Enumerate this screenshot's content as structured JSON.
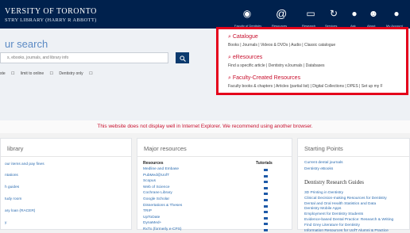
{
  "header": {
    "university": "VERSITY OF TORONTO",
    "library": "STRY LIBRARY (HARRY R ABBOTT)",
    "nav": [
      {
        "label": "Faculty of Dentistry",
        "icon": "target-icon"
      },
      {
        "label": "Resources",
        "icon": "at-icon"
      },
      {
        "label": "Research",
        "icon": "laptop-icon"
      },
      {
        "label": "Services",
        "icon": "refresh-icon"
      },
      {
        "label": "Ask",
        "icon": "chat-icon"
      },
      {
        "label": "About",
        "icon": "face-icon"
      },
      {
        "label": "My Account",
        "icon": "user-icon"
      }
    ]
  },
  "search": {
    "title": "ur search",
    "placeholder": "s, ebooks, journals, and library info",
    "options": [
      "ste",
      "limit to online",
      "Dentistry only"
    ]
  },
  "callout": {
    "items": [
      {
        "title": "Catalogue",
        "desc": "Books | Journals | Videos & DVDs | Audio | Classic catalogue"
      },
      {
        "title": "eResources",
        "desc": "Find a specific article | Dentistry eJournals | Databases"
      },
      {
        "title": "Faculty-Created Resources",
        "desc": "Faculty books & chapters | Articles (partial list) | Digital Collections | DPES | Set up my F"
      }
    ]
  },
  "warning": "This website does not display well in Internet Explorer. We recommend using another browser.",
  "library_col": {
    "title": "library",
    "links": [
      "our items and pay fines",
      "ntations",
      "h guides",
      "tudy room",
      "ary loan (RACER)",
      "y"
    ]
  },
  "resources_col": {
    "title": "Major resources",
    "head_left": "Resources",
    "head_right": "Tutorials",
    "links": [
      "Medline and Embase",
      "PubMed@UofT",
      "Scopus",
      "Web of Science",
      "Cochrane Library",
      "Google Scholar",
      "Dissertations & Theses",
      "TRIP",
      "UpToDate",
      "DynaMed+",
      "RxTx (formerly e-CPS)"
    ]
  },
  "starting_col": {
    "title": "Starting Points",
    "top_links": [
      "Current dental journals",
      "Dentistry eBooks"
    ],
    "guides_title": "Dentistry Research Guides",
    "guides": [
      "3D Printing in Dentistry",
      "Clinical Decision-making Resources for Dentistry",
      "Dental and Oral Health Statistics and Data",
      "Dentistry Mobile Apps",
      "Employment for Dentistry Students",
      "Evidence-based Dental Practice: Research & Writing",
      "Find Grey Literature for Dentistry",
      "Information Resources for UofT Alumni & Practice"
    ]
  }
}
